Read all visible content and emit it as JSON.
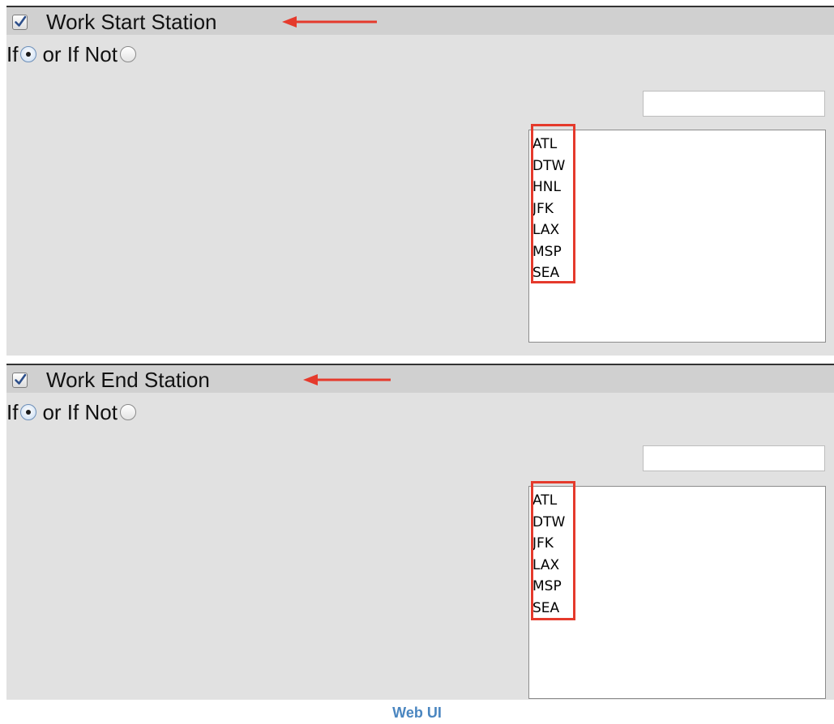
{
  "sections": {
    "start": {
      "title": "Work Start Station",
      "checked": true,
      "if_label": "If",
      "or_if_not_label": "or If Not",
      "selected_condition": "If",
      "filter_value": "",
      "stations": [
        "ATL",
        "DTW",
        "HNL",
        "JFK",
        "LAX",
        "MSP",
        "SEA"
      ]
    },
    "end": {
      "title": "Work End Station",
      "checked": true,
      "if_label": "If",
      "or_if_not_label": "or If Not",
      "selected_condition": "If",
      "filter_value": "",
      "stations": [
        "ATL",
        "DTW",
        "JFK",
        "LAX",
        "MSP",
        "SEA"
      ]
    }
  },
  "caption": "Web UI",
  "colors": {
    "annotation": "#e53a2c",
    "caption": "#4a86c0",
    "panel": "#e1e1e1",
    "header": "#d0d0d0"
  },
  "icons": {
    "checkbox": "checkmark-checkbox-icon",
    "radio": "radio-button-icon",
    "arrow": "left-arrow-annotation-icon"
  }
}
